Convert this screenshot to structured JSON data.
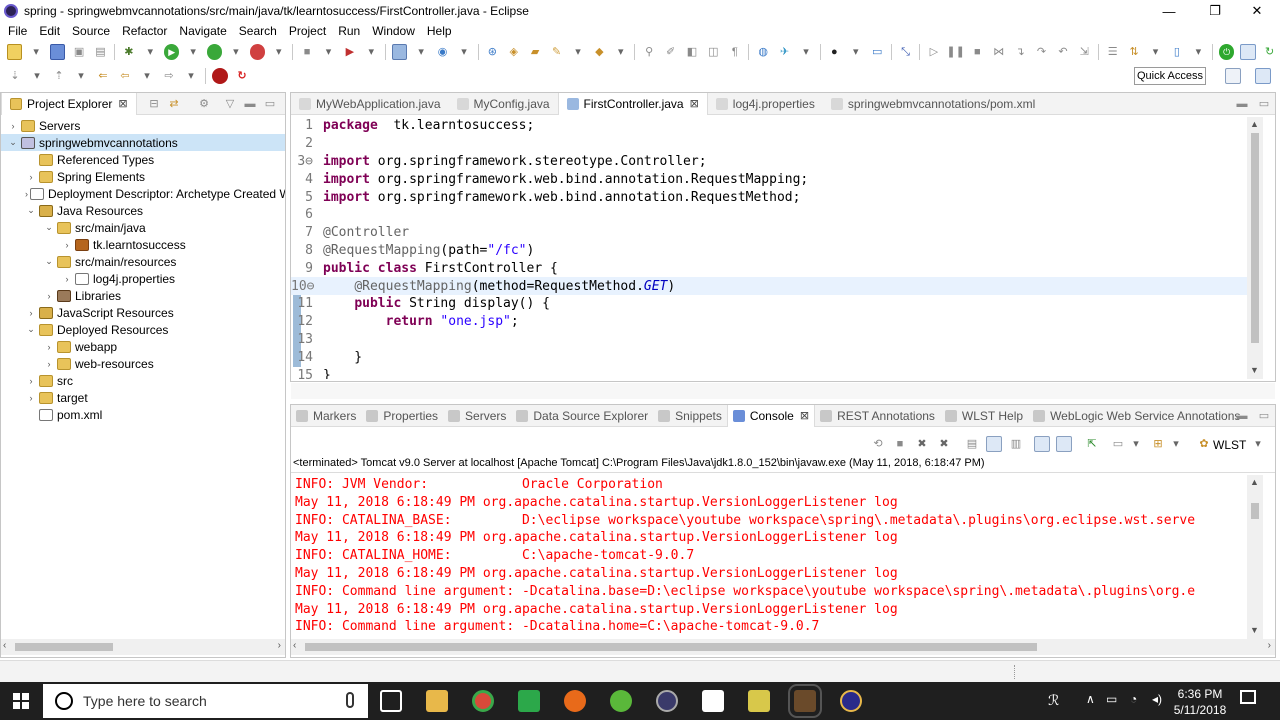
{
  "window": {
    "title": "spring - springwebmvcannotations/src/main/java/tk/learntosuccess/FirstController.java - Eclipse",
    "minimize": "—",
    "maximize": "❐",
    "close": "✕"
  },
  "menu": [
    "File",
    "Edit",
    "Source",
    "Refactor",
    "Navigate",
    "Search",
    "Project",
    "Run",
    "Window",
    "Help"
  ],
  "quick_access": "Quick Access",
  "explorer": {
    "tab_label": "Project Explorer",
    "tab_close": "⊠",
    "items": [
      {
        "label": "Servers",
        "indent": 0,
        "arrow": "›",
        "icon": "folder"
      },
      {
        "label": "springwebmvcannotations",
        "indent": 0,
        "arrow": "⌄",
        "icon": "proj",
        "selected": true
      },
      {
        "label": "Referenced Types",
        "indent": 1,
        "arrow": "",
        "icon": "folder"
      },
      {
        "label": "Spring Elements",
        "indent": 1,
        "arrow": "›",
        "icon": "folder"
      },
      {
        "label": "Deployment Descriptor: Archetype Created W",
        "indent": 1,
        "arrow": "›",
        "icon": "file"
      },
      {
        "label": "Java Resources",
        "indent": 1,
        "arrow": "⌄",
        "icon": "jsres"
      },
      {
        "label": "src/main/java",
        "indent": 2,
        "arrow": "⌄",
        "icon": "folder"
      },
      {
        "label": "tk.learntosuccess",
        "indent": 3,
        "arrow": "›",
        "icon": "pkg"
      },
      {
        "label": "src/main/resources",
        "indent": 2,
        "arrow": "⌄",
        "icon": "folder"
      },
      {
        "label": "log4j.properties",
        "indent": 3,
        "arrow": "›",
        "icon": "file"
      },
      {
        "label": "Libraries",
        "indent": 2,
        "arrow": "›",
        "icon": "jar"
      },
      {
        "label": "JavaScript Resources",
        "indent": 1,
        "arrow": "›",
        "icon": "jsres"
      },
      {
        "label": "Deployed Resources",
        "indent": 1,
        "arrow": "⌄",
        "icon": "folder"
      },
      {
        "label": "webapp",
        "indent": 2,
        "arrow": "›",
        "icon": "folder"
      },
      {
        "label": "web-resources",
        "indent": 2,
        "arrow": "›",
        "icon": "folder"
      },
      {
        "label": "src",
        "indent": 1,
        "arrow": "›",
        "icon": "folder"
      },
      {
        "label": "target",
        "indent": 1,
        "arrow": "›",
        "icon": "folder"
      },
      {
        "label": "pom.xml",
        "indent": 1,
        "arrow": "",
        "icon": "file"
      }
    ]
  },
  "editor": {
    "tabs": [
      {
        "label": "MyWebApplication.java",
        "active": false
      },
      {
        "label": "MyConfig.java",
        "active": false
      },
      {
        "label": "FirstController.java",
        "active": true,
        "close": "⊠"
      },
      {
        "label": "log4j.properties",
        "active": false
      },
      {
        "label": "springwebmvcannotations/pom.xml",
        "active": false
      }
    ],
    "lines": [
      {
        "n": "1",
        "parts": [
          [
            "kw",
            "package"
          ],
          [
            "",
            "  tk.learntosuccess;"
          ]
        ]
      },
      {
        "n": "2",
        "parts": []
      },
      {
        "n": "3⊖",
        "parts": [
          [
            "kw",
            "import"
          ],
          [
            "",
            " org.springframework.stereotype.Controller;"
          ]
        ]
      },
      {
        "n": "4",
        "parts": [
          [
            "kw",
            "import"
          ],
          [
            "",
            " org.springframework.web.bind.annotation.RequestMapping;"
          ]
        ]
      },
      {
        "n": "5",
        "parts": [
          [
            "kw",
            "import"
          ],
          [
            "",
            " org.springframework.web.bind.annotation.RequestMethod;"
          ]
        ]
      },
      {
        "n": "6",
        "parts": []
      },
      {
        "n": "7",
        "parts": [
          [
            "an",
            "@Controller"
          ]
        ]
      },
      {
        "n": "8",
        "parts": [
          [
            "an",
            "@RequestMapping"
          ],
          [
            "",
            "(path="
          ],
          [
            "str",
            "\"/fc\""
          ],
          [
            "",
            ")"
          ]
        ]
      },
      {
        "n": "9",
        "parts": [
          [
            "kw",
            "public class"
          ],
          [
            "",
            " FirstController {"
          ]
        ]
      },
      {
        "n": "10⊖",
        "hl": true,
        "parts": [
          [
            "",
            "    "
          ],
          [
            "an",
            "@RequestMapping"
          ],
          [
            "",
            "(method=RequestMethod."
          ],
          [
            "it",
            "GET"
          ],
          [
            "",
            ")"
          ]
        ]
      },
      {
        "n": "11",
        "parts": [
          [
            "",
            "    "
          ],
          [
            "kw",
            "public"
          ],
          [
            "",
            " String display() {"
          ]
        ]
      },
      {
        "n": "12",
        "parts": [
          [
            "",
            "        "
          ],
          [
            "kw",
            "return"
          ],
          [
            "",
            " "
          ],
          [
            "str",
            "\"one.jsp\""
          ],
          [
            "",
            ";"
          ]
        ]
      },
      {
        "n": "13",
        "parts": []
      },
      {
        "n": "14",
        "parts": [
          [
            "",
            "    }"
          ]
        ]
      },
      {
        "n": "15",
        "parts": [
          [
            "",
            "}"
          ]
        ]
      }
    ]
  },
  "bottom": {
    "tabs": [
      {
        "label": "Markers",
        "active": false
      },
      {
        "label": "Properties",
        "active": false
      },
      {
        "label": "Servers",
        "active": false
      },
      {
        "label": "Data Source Explorer",
        "active": false
      },
      {
        "label": "Snippets",
        "active": false
      },
      {
        "label": "Console",
        "active": true,
        "close": "⊠"
      },
      {
        "label": "REST Annotations",
        "active": false
      },
      {
        "label": "WLST Help",
        "active": false
      },
      {
        "label": "WebLogic Web Service Annotations",
        "active": false
      }
    ],
    "wlst_label": "WLST",
    "status": "<terminated> Tomcat v9.0 Server at localhost [Apache Tomcat] C:\\Program Files\\Java\\jdk1.8.0_152\\bin\\javaw.exe (May 11, 2018, 6:18:47 PM)",
    "console_lines": [
      "INFO: JVM Vendor:            Oracle Corporation",
      "May 11, 2018 6:18:49 PM org.apache.catalina.startup.VersionLoggerListener log",
      "INFO: CATALINA_BASE:         D:\\eclipse workspace\\youtube workspace\\spring\\.metadata\\.plugins\\org.eclipse.wst.serve",
      "May 11, 2018 6:18:49 PM org.apache.catalina.startup.VersionLoggerListener log",
      "INFO: CATALINA_HOME:         C:\\apache-tomcat-9.0.7",
      "May 11, 2018 6:18:49 PM org.apache.catalina.startup.VersionLoggerListener log",
      "INFO: Command line argument: -Dcatalina.base=D:\\eclipse workspace\\youtube workspace\\spring\\.metadata\\.plugins\\org.e",
      "May 11, 2018 6:18:49 PM org.apache.catalina.startup.VersionLoggerListener log",
      "INFO: Command line argument: -Dcatalina.home=C:\\apache-tomcat-9.0.7"
    ]
  },
  "taskbar": {
    "search_placeholder": "Type here to search",
    "time": "6:36 PM",
    "date": "5/11/2018"
  }
}
